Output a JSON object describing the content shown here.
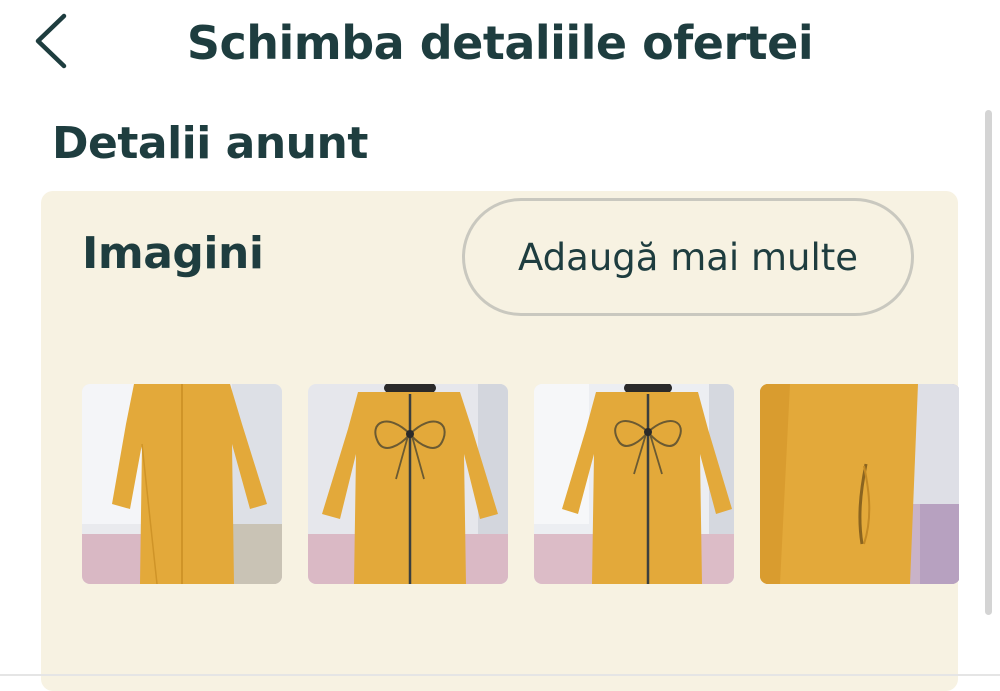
{
  "header": {
    "back_icon": "chevron-left-icon",
    "title": "Schimba detaliile ofertei"
  },
  "section": {
    "title": "Detalii anunt"
  },
  "images": {
    "label": "Imagini",
    "add_button": "Adaugă mai multe",
    "thumbnails": [
      {
        "name": "mustard-dress-front"
      },
      {
        "name": "mustard-dress-zipper-bow-front"
      },
      {
        "name": "mustard-dress-zipper-bow-front-2"
      },
      {
        "name": "mustard-dress-side-pocket"
      }
    ]
  },
  "colors": {
    "text": "#1e3d3f",
    "card_background": "#f7f2e2",
    "button_border": "#c9c8bf",
    "dress": "#e3a93a"
  }
}
